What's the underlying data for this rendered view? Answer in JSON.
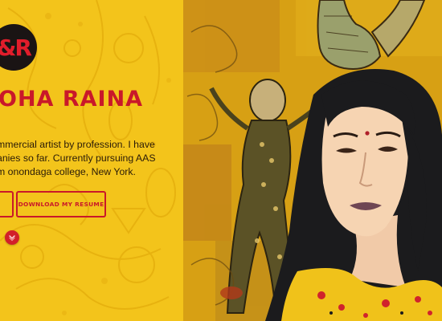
{
  "logo": {
    "text": "&R",
    "icon": "rr-monogram-logo"
  },
  "hero": {
    "name": "OHA RAINA",
    "bio_lines": [
      "mmercial artist by profession. I have",
      "anies so far. Currently pursuing AAS",
      "m onondaga college, New York."
    ]
  },
  "actions": {
    "resume_label": "DOWNLOAD MY RESUME",
    "scroll_icon": "chevron-down-icon"
  },
  "colors": {
    "background": "#f3c41b",
    "accent": "#c9182a",
    "logo_bg": "#1a1414",
    "text": "#2a1b08"
  }
}
